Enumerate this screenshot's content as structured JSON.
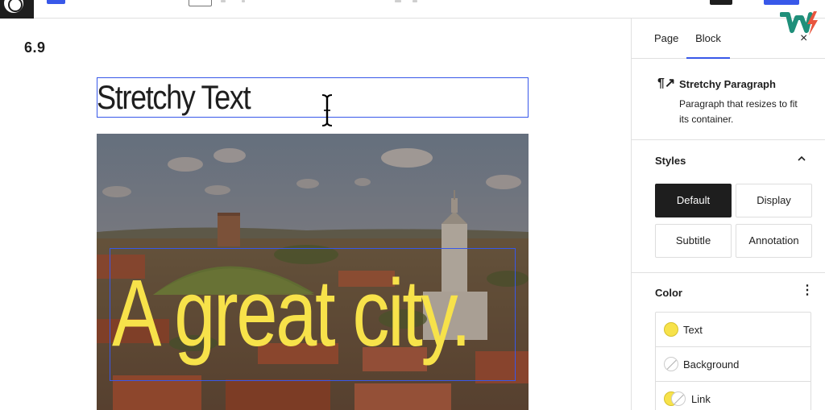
{
  "app": {
    "version": "6.9"
  },
  "toolbar": {
    "wp_icon": "wordpress-logo-icon"
  },
  "canvas": {
    "stretchy_text": "Stretchy Text",
    "cover_text": "A great city."
  },
  "sidebar": {
    "tabs": [
      {
        "label": "Page"
      },
      {
        "label": "Block"
      }
    ],
    "close_icon": "×",
    "block": {
      "icon": "¶↗",
      "title": "Stretchy Paragraph",
      "description": "Paragraph that resizes to fit its container."
    },
    "styles": {
      "title": "Styles",
      "options": [
        {
          "label": "Default"
        },
        {
          "label": "Display"
        },
        {
          "label": "Subtitle"
        },
        {
          "label": "Annotation"
        }
      ],
      "selected": "Default"
    },
    "color": {
      "title": "Color",
      "menu_icon": "⋮",
      "items": [
        {
          "label": "Text"
        },
        {
          "label": "Background"
        },
        {
          "label": "Link"
        }
      ]
    }
  },
  "colors": {
    "accent": "#3858e9",
    "cover_text": "#f7e24a",
    "dark": "#1e1e1e"
  }
}
